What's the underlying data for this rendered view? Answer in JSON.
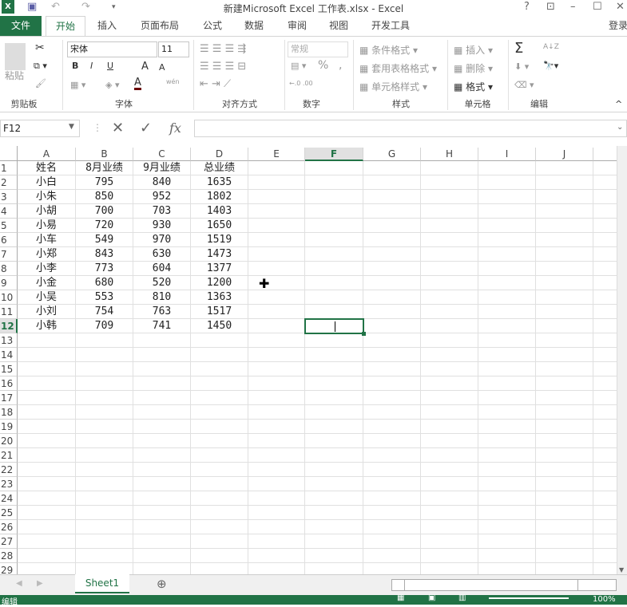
{
  "title": "新建Microsoft Excel 工作表.xlsx - Excel",
  "window_controls": [
    "?",
    "⊡",
    "–",
    "☐",
    "✕"
  ],
  "quick_access": {
    "save": "💾",
    "undo": "↶",
    "redo": "↷",
    "customize": "▾"
  },
  "login": "登录",
  "tabs": [
    "文件",
    "开始",
    "插入",
    "页面布局",
    "公式",
    "数据",
    "审阅",
    "视图",
    "开发工具"
  ],
  "ribbon": {
    "clipboard": {
      "label": "剪贴板",
      "paste": "粘贴"
    },
    "font": {
      "label": "字体",
      "name": "宋体",
      "size": "11",
      "bold": "B",
      "italic": "I",
      "underline": "U",
      "grow": "A",
      "shrink": "A",
      "color": "A",
      "phonetic": "wén"
    },
    "align": {
      "label": "对齐方式"
    },
    "number": {
      "label": "数字",
      "format": "常规",
      "percent": "%",
      "comma": ","
    },
    "styles": {
      "label": "样式",
      "cond": "条件格式",
      "table": "套用表格格式",
      "cell": "单元格样式"
    },
    "cells": {
      "label": "单元格",
      "insert": "插入",
      "delete": "删除",
      "format": "格式"
    },
    "editing": {
      "label": "编辑",
      "sum": "Σ",
      "sort": "A↓Z"
    }
  },
  "name_box": "F12",
  "formula_icons": {
    "cancel": "✕",
    "enter": "✓",
    "fx": "fx"
  },
  "formula_value": "",
  "columns": [
    "A",
    "B",
    "C",
    "D",
    "E",
    "F",
    "G",
    "H",
    "I",
    "J"
  ],
  "selected_cell": "F12",
  "rows": [
    [
      "姓名",
      "8月业绩",
      "9月业绩",
      "总业绩"
    ],
    [
      "小白",
      "795",
      "840",
      "1635"
    ],
    [
      "小朱",
      "850",
      "952",
      "1802"
    ],
    [
      "小胡",
      "700",
      "703",
      "1403"
    ],
    [
      "小易",
      "720",
      "930",
      "1650"
    ],
    [
      "小车",
      "549",
      "970",
      "1519"
    ],
    [
      "小郑",
      "843",
      "630",
      "1473"
    ],
    [
      "小李",
      "773",
      "604",
      "1377"
    ],
    [
      "小金",
      "680",
      "520",
      "1200"
    ],
    [
      "小吴",
      "553",
      "810",
      "1363"
    ],
    [
      "小刘",
      "754",
      "763",
      "1517"
    ],
    [
      "小韩",
      "709",
      "741",
      "1450"
    ]
  ],
  "row_count": 29,
  "sheet_tabs": [
    "Sheet1"
  ],
  "status": {
    "mode": "编辑",
    "zoom": "100%"
  },
  "accent": "#217346"
}
